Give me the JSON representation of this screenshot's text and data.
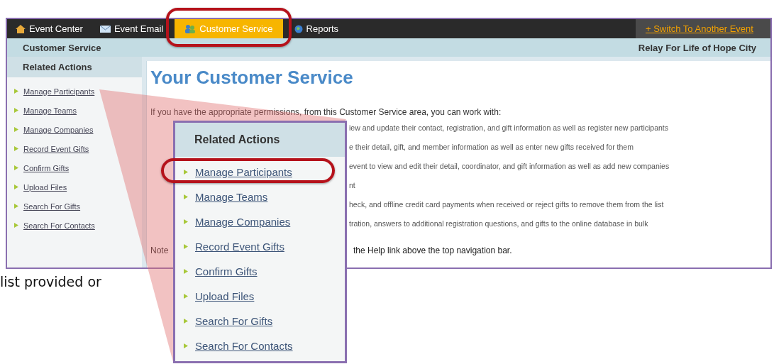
{
  "nav": {
    "tabs": [
      {
        "label": "Event Center",
        "selected": false
      },
      {
        "label": "Event Email",
        "selected": false
      },
      {
        "label": "Customer Service",
        "selected": true
      },
      {
        "label": "Reports",
        "selected": false
      }
    ],
    "switch_link": "+ Switch To Another Event"
  },
  "subheader": {
    "title": "Customer Service",
    "event": "Relay For Life of Hope City"
  },
  "sidebar": {
    "heading": "Related Actions",
    "items": [
      "Manage Participants",
      "Manage Teams",
      "Manage Companies",
      "Record Event Gifts",
      "Confirm Gifts",
      "Upload Files",
      "Search For Gifts",
      "Search For Contacts"
    ]
  },
  "main": {
    "heading": "Your Customer Service",
    "intro": "If you have the appropriate permissions, from this Customer Service area, you can work with:",
    "lines": [
      "iew and update their contact, registration, and gift information as well as register new participants",
      "e their detail, gift, and member information as well as enter new gifts received for them",
      "event to view and edit their detail, coordinator, and gift information as well as add new companies",
      "nt",
      "heck, and offline credit card payments when received or reject gifts to remove them from the list",
      "tration, answers to additional registration questions, and gifts to the online database in bulk"
    ],
    "note_start": "Note",
    "note_end": "the Help link above the top navigation bar."
  },
  "callout": {
    "heading": "Related Actions",
    "items": [
      {
        "label": "Manage Participants",
        "highlighted": true
      },
      {
        "label": "Manage Teams",
        "highlighted": false
      },
      {
        "label": "Manage Companies",
        "highlighted": false
      },
      {
        "label": "Record Event Gifts",
        "highlighted": false
      },
      {
        "label": "Confirm Gifts",
        "highlighted": false
      },
      {
        "label": "Upload Files",
        "highlighted": false
      },
      {
        "label": "Search For Gifts",
        "highlighted": false
      },
      {
        "label": "Search For Contacts",
        "highlighted": false
      }
    ]
  },
  "slide_text": "list provided or"
}
